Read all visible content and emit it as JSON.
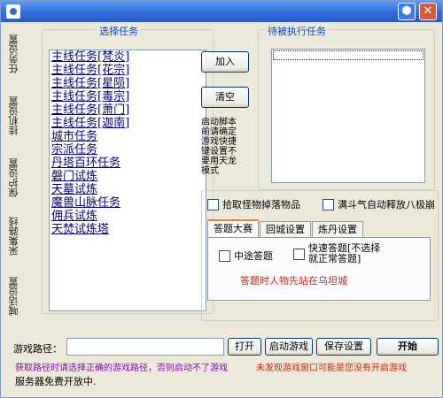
{
  "side_tabs": [
    "任务设置",
    "挂机设置",
    "保护设置",
    "采集路线",
    "喊话设置"
  ],
  "left_group": {
    "title": "选择任务",
    "tasks": [
      "主线任务[梵炎]",
      "主线任务[花宗]",
      "主线任务[星陨]",
      "主线任务[毒宗]",
      "主线任务[萧门]",
      "主线任务[迦南]",
      "城市任务",
      "宗派任务",
      "丹塔百环任务",
      "磐门试炼",
      "天墓试炼",
      "魔兽山脉任务",
      "佣兵试炼",
      "天焚试炼塔"
    ]
  },
  "buttons": {
    "add": "加入",
    "clear": "清空"
  },
  "note": "启动脚本前请确定游戏快捷键设置不要用天龙模式",
  "right_group": {
    "title": "待被执行任务"
  },
  "checkboxes": {
    "pickup": "拾取怪物掉落物品",
    "auto_skill": "满斗气自动释放八极崩"
  },
  "tabs": [
    "答题大赛",
    "回城设置",
    "炼丹设置"
  ],
  "quiz": {
    "halfway": "中途答题",
    "quick": "快速答题[不选择就正常答题]",
    "hint": "答题时人物先站在乌坦城"
  },
  "bottom": {
    "path_label": "游戏路径：",
    "path_value": "",
    "open": "打开",
    "start_game": "启动游戏",
    "save": "保存设置",
    "begin": "开始",
    "warn1": "获取路径时请选择正确的游戏路径，否则启动不了游戏",
    "warn2": "未发现游戏窗口可能是您没有开启游戏",
    "server_note": "服务器免费开放中."
  },
  "colors": {
    "title_link": "#0046d5",
    "task_link": "#000080",
    "warn_purple": "#8a00c8",
    "warn_red": "#d81e06",
    "hint_red": "#d81e06"
  }
}
